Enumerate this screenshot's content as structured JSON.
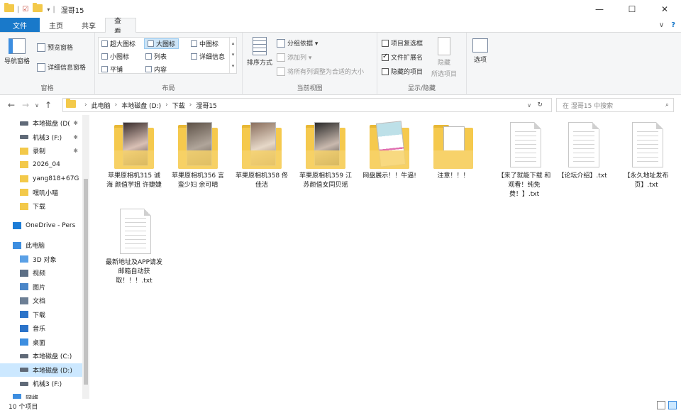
{
  "window": {
    "title": "湿哥15",
    "minimize": "—",
    "maximize": "☐",
    "close": "✕"
  },
  "ribbon_tabs": [
    "文件",
    "主页",
    "共享",
    "查看"
  ],
  "ribbon_right": {
    "collapse": "∨",
    "help": "?"
  },
  "ribbon": {
    "panes": {
      "nav_pane": "导航窗格",
      "preview_pane": "预览窗格",
      "details_pane": "详细信息窗格",
      "label": "窗格"
    },
    "layout": {
      "items": [
        "超大图标",
        "大图标",
        "中图标",
        "小图标",
        "列表",
        "详细信息",
        "平铺",
        "内容"
      ],
      "selected": "大图标",
      "label": "布局"
    },
    "current_view": {
      "sort": "排序方式",
      "group_by": "分组依据 ▾",
      "add_columns": "添加列 ▾",
      "size_cols": "将所有列调整为合适的大小",
      "label": "当前视图"
    },
    "show_hide": {
      "item_checkboxes": "项目复选框",
      "file_ext": "文件扩展名",
      "hidden_items": "隐藏的项目",
      "hide_selected_line1": "隐藏",
      "hide_selected_line2": "所选项目",
      "label": "显示/隐藏"
    },
    "options": {
      "label": "选项"
    }
  },
  "address": {
    "crumbs": [
      "此电脑",
      "本地磁盘 (D:)",
      "下载",
      "湿哥15"
    ],
    "search_placeholder": "在 湿哥15 中搜索"
  },
  "sidebar": [
    {
      "label": "本地磁盘 (D(",
      "pinned": true,
      "type": "drive"
    },
    {
      "label": "机械3 (F:)",
      "pinned": true,
      "type": "drive"
    },
    {
      "label": "录制",
      "pinned": true,
      "type": "folder"
    },
    {
      "label": "2026_04",
      "pinned": false,
      "type": "folder"
    },
    {
      "label": "yang818+67G",
      "pinned": false,
      "type": "folder"
    },
    {
      "label": "嘿叽小喵",
      "pinned": false,
      "type": "folder"
    },
    {
      "label": "下载",
      "pinned": false,
      "type": "folder"
    },
    {
      "label": "",
      "pinned": false,
      "type": "spacer"
    },
    {
      "label": "OneDrive - Pers",
      "pinned": false,
      "type": "onedrive"
    },
    {
      "label": "",
      "pinned": false,
      "type": "spacer"
    },
    {
      "label": "此电脑",
      "pinned": false,
      "type": "pc"
    },
    {
      "label": "3D 对象",
      "pinned": false,
      "type": "3d"
    },
    {
      "label": "视频",
      "pinned": false,
      "type": "video"
    },
    {
      "label": "图片",
      "pinned": false,
      "type": "pictures"
    },
    {
      "label": "文档",
      "pinned": false,
      "type": "docs"
    },
    {
      "label": "下载",
      "pinned": false,
      "type": "downloads"
    },
    {
      "label": "音乐",
      "pinned": false,
      "type": "music"
    },
    {
      "label": "桌面",
      "pinned": false,
      "type": "desktop"
    },
    {
      "label": "本地磁盘 (C:)",
      "pinned": false,
      "type": "drive"
    },
    {
      "label": "本地磁盘 (D:)",
      "pinned": false,
      "type": "drive",
      "selected": true
    },
    {
      "label": "机械3 (F:)",
      "pinned": false,
      "type": "drive"
    },
    {
      "label": "网络",
      "pinned": false,
      "type": "network"
    }
  ],
  "files": [
    {
      "name": "苹果原相机315 诚海 颜值学姐 许婕婕",
      "kind": "photo-folder",
      "c1": "#3a2e2e",
      "c2": "#d9c0b5"
    },
    {
      "name": "苹果原相机356 言蛮少妇 余可晴",
      "kind": "photo-folder",
      "c1": "#5e5248",
      "c2": "#b0a59a"
    },
    {
      "name": "苹果原相机358 佟佳洁",
      "kind": "photo-folder",
      "c1": "#8a6f5e",
      "c2": "#e6d8c8"
    },
    {
      "name": "苹果原相机359 江苏颜值女同贝瑶",
      "kind": "photo-folder",
      "c1": "#2b2b2b",
      "c2": "#c9b9ae"
    },
    {
      "name": "网盘展示！！牛逼!",
      "kind": "screen-folder",
      "c1": "#bde0e8",
      "c2": "#e06fb0"
    },
    {
      "name": "注意！！！",
      "kind": "plain-folder",
      "c1": "#ffffff",
      "c2": "#ffffff"
    },
    {
      "name": "【来了就能下载 和观看！纯免费！】.txt",
      "kind": "txt"
    },
    {
      "name": "【论坛介绍】.txt",
      "kind": "txt"
    },
    {
      "name": "【永久地址发布页】.txt",
      "kind": "txt"
    },
    {
      "name": "最新地址及APP请发邮箱自动获取！！！.txt",
      "kind": "txt"
    }
  ],
  "status": {
    "count": "10 个项目"
  }
}
